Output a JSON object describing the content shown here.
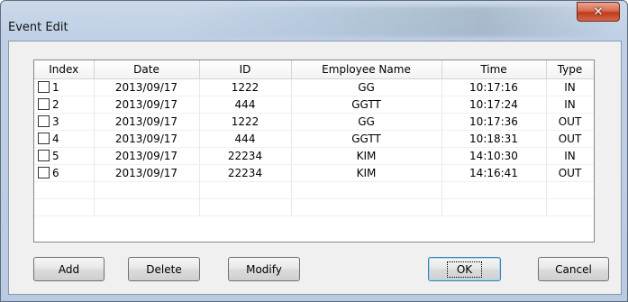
{
  "window": {
    "title": "Event Edit",
    "close_glyph": "✕"
  },
  "table": {
    "columns": [
      "Index",
      "Date",
      "ID",
      "Employee Name",
      "Time",
      "Type"
    ],
    "rows": [
      {
        "index": "1",
        "date": "2013/09/17",
        "id": "1222",
        "name": "GG",
        "time": "10:17:16",
        "type": "IN"
      },
      {
        "index": "2",
        "date": "2013/09/17",
        "id": "444",
        "name": "GGTT",
        "time": "10:17:24",
        "type": "IN"
      },
      {
        "index": "3",
        "date": "2013/09/17",
        "id": "1222",
        "name": "GG",
        "time": "10:17:36",
        "type": "OUT"
      },
      {
        "index": "4",
        "date": "2013/09/17",
        "id": "444",
        "name": "GGTT",
        "time": "10:18:31",
        "type": "OUT"
      },
      {
        "index": "5",
        "date": "2013/09/17",
        "id": "22234",
        "name": "KIM",
        "time": "14:10:30",
        "type": "IN"
      },
      {
        "index": "6",
        "date": "2013/09/17",
        "id": "22234",
        "name": "KIM",
        "time": "14:16:41",
        "type": "OUT"
      }
    ]
  },
  "buttons": {
    "add": "Add",
    "delete": "Delete",
    "modify": "Modify",
    "ok": "OK",
    "cancel": "Cancel"
  }
}
